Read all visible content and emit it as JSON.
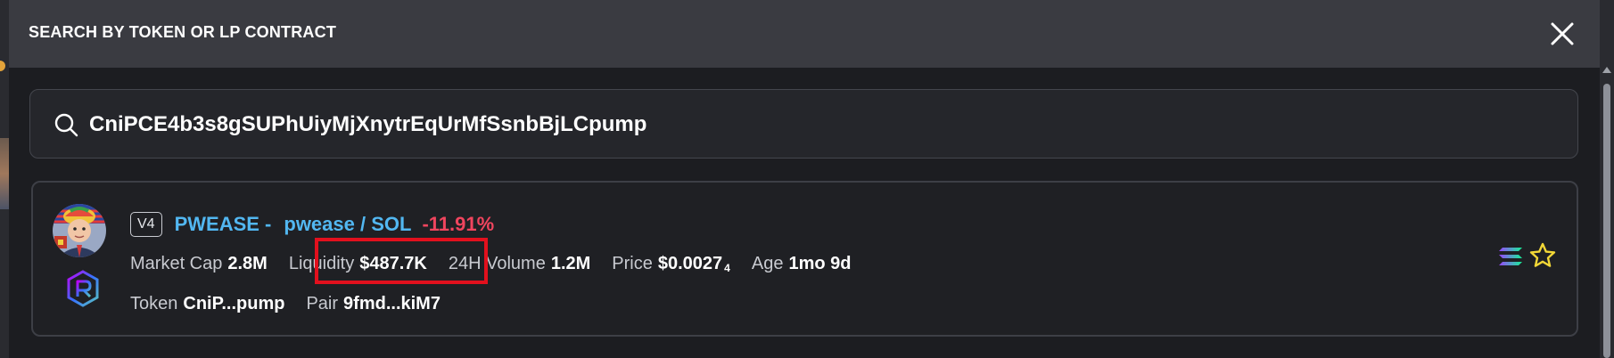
{
  "modal": {
    "title": "SEARCH BY TOKEN OR LP CONTRACT"
  },
  "search": {
    "value": "CniPCE4b3s8gSUPhUiyMjXnytrEqUrMfSsnbBjLCpump"
  },
  "result": {
    "version": "V4",
    "token_name": "PWEASE -",
    "pair": "pwease / SOL",
    "change": "-11.91%",
    "stats": {
      "market_cap_label": "Market Cap",
      "market_cap": "2.8M",
      "liquidity_label": "Liquidity",
      "liquidity": "$487.7K",
      "volume_label": "24H Volume",
      "volume": "1.2M",
      "price_label": "Price",
      "price": "$0.0027",
      "price_subscript": "4",
      "age_label": "Age",
      "age": "1mo 9d"
    },
    "token_label": "Token",
    "token_addr": "CniP...pump",
    "pair_label": "Pair",
    "pair_addr": "9fmd...kiM7"
  },
  "colors": {
    "link_blue": "#52b7f1",
    "negative_red": "#f0455e",
    "highlight_red": "#e2101d",
    "star_yellow": "#f2d737"
  },
  "icons": {
    "close": "close-icon",
    "search": "search-icon",
    "dex": "raydium-icon",
    "chain": "solana-icon",
    "favorite": "star-icon"
  }
}
